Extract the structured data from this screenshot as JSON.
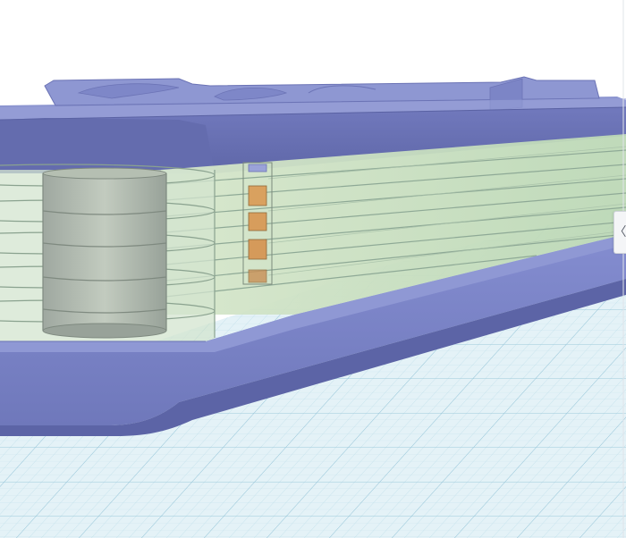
{
  "workplane": {
    "background": "#ffffff",
    "plane_color": "#dcedf3",
    "minor_grid_color": "#b8dbe7",
    "major_grid_color": "#8fc2d6"
  },
  "model": {
    "base_color": "#7b84c5",
    "body_color": "#6a72b4",
    "top_color": "#8a93cf",
    "glass_color": "#cfe4c6",
    "magnet_color": "#d49a5c"
  },
  "panel_toggle": {
    "glyph": "〈",
    "icon": "chevron-left-icon"
  }
}
